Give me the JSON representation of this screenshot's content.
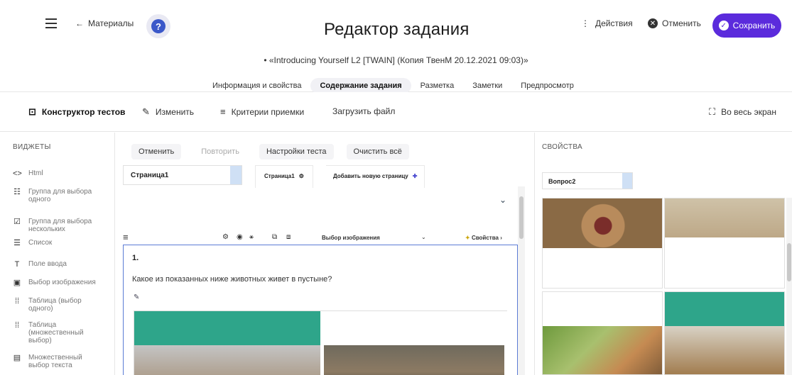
{
  "header": {
    "back_label": "Материалы",
    "help_label": "?",
    "title": "Редактор задания",
    "subtitle": "• «Introducing Yourself L2 [TWAIN] (Копия ТвенМ 20.12.2021 09:03)»",
    "actions_label": "Действия",
    "cancel_label": "Отменить",
    "save_label": "Сохранить"
  },
  "tabs": [
    {
      "label": "Информация и свойства",
      "active": false
    },
    {
      "label": "Содержание задания",
      "active": true
    },
    {
      "label": "Разметка",
      "active": false
    },
    {
      "label": "Заметки",
      "active": false
    },
    {
      "label": "Предпросмотр",
      "active": false
    }
  ],
  "toolbar": {
    "test_builder": "Конструктор тестов",
    "edit": "Изменить",
    "criteria": "Критерии приемки",
    "upload": "Загрузить файл",
    "fullscreen": "Во весь экран"
  },
  "widgets": {
    "title": "ВИДЖЕТЫ",
    "items": [
      {
        "icon": "<>",
        "label": "Html"
      },
      {
        "icon": "☷",
        "label": "Группа для выбора одного"
      },
      {
        "icon": "☑",
        "label": "Группа для выбора нескольких"
      },
      {
        "icon": "☰",
        "label": "Список"
      },
      {
        "icon": "T",
        "label": "Поле ввода"
      },
      {
        "icon": "▣",
        "label": "Выбор изображения"
      },
      {
        "icon": "⁞⁞",
        "label": "Таблица (выбор одного)"
      },
      {
        "icon": "⁞⁞",
        "label": "Таблица (множественный выбор)"
      },
      {
        "icon": "▤",
        "label": "Множественный выбор текста"
      }
    ]
  },
  "editor": {
    "undo": "Отменить",
    "redo": "Повторить",
    "test_settings": "Настройки теста",
    "clear_all": "Очистить всё",
    "page_select": "Страница1",
    "page_chip": "Страница1",
    "add_page": "Добавить новую страницу",
    "question_type": "Выбор изображения",
    "properties_link": "Свойства",
    "question_number": "1.",
    "question_text": "Какое из показанных ниже животных живет в пустыне?"
  },
  "properties": {
    "title": "СВОЙСТВА",
    "question_select": "Вопрос2"
  }
}
